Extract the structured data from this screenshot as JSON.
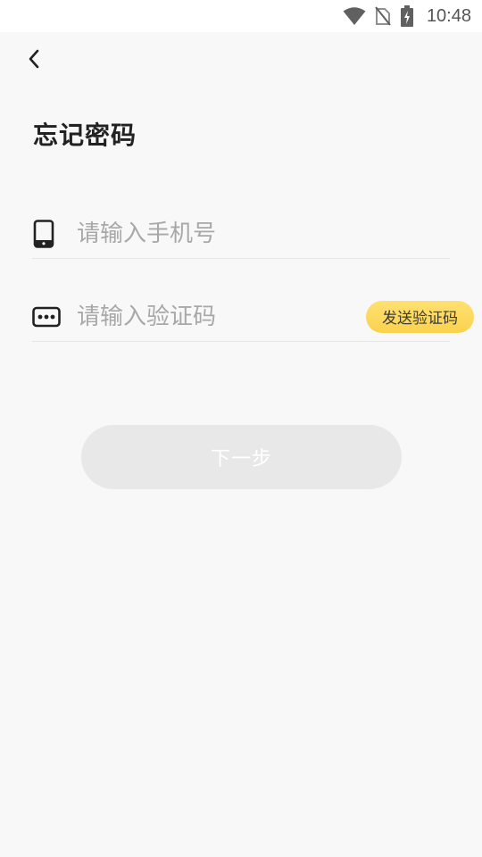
{
  "status_bar": {
    "time": "10:48",
    "icons": [
      "wifi-icon",
      "no-sim-icon",
      "battery-charging-icon"
    ]
  },
  "header": {
    "back_icon": "chevron-left-icon",
    "title": "忘记密码"
  },
  "form": {
    "phone": {
      "icon": "phone-icon",
      "placeholder": "请输入手机号",
      "value": ""
    },
    "code": {
      "icon": "code-dots-icon",
      "placeholder": "请输入验证码",
      "value": "",
      "send_label": "发送验证码"
    },
    "next_label": "下一步"
  },
  "colors": {
    "accent": "#fbd24e",
    "background": "#f8f8f8",
    "disabled_button": "#e8e8e8"
  }
}
